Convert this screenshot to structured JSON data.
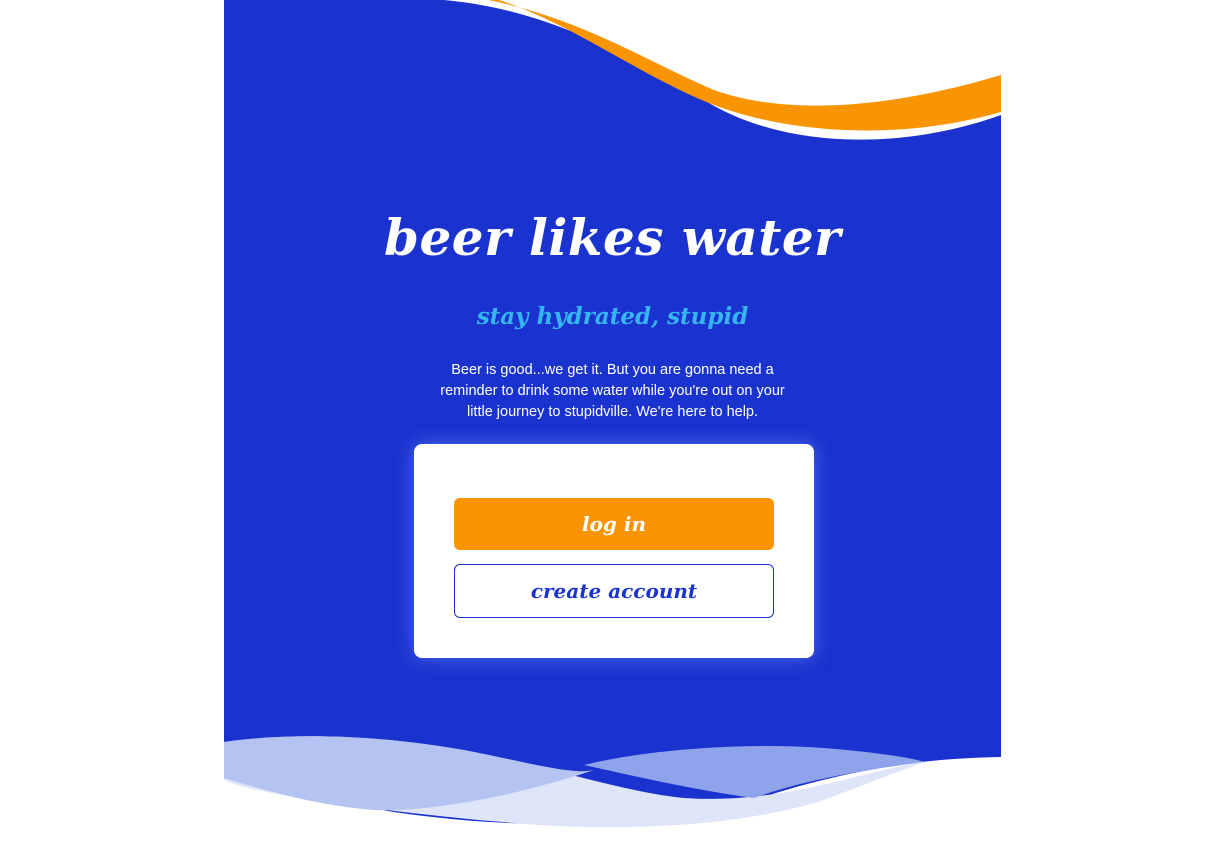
{
  "hero": {
    "title": "beer likes water",
    "subtitle": "stay hydrated, stupid",
    "intro": "Beer is good...we get it. But you are gonna need a reminder to drink some water while you're out on your little journey to stupidville. We're here to help."
  },
  "auth_card": {
    "login_label": "log in",
    "create_account_label": "create account"
  },
  "colors": {
    "primary_blue": "#1a33cf",
    "accent_orange": "#f99503",
    "subtitle_cyan": "#35b6f0",
    "wave_light": "#b4c3f2",
    "wave_lighter": "#dfe5f9"
  }
}
